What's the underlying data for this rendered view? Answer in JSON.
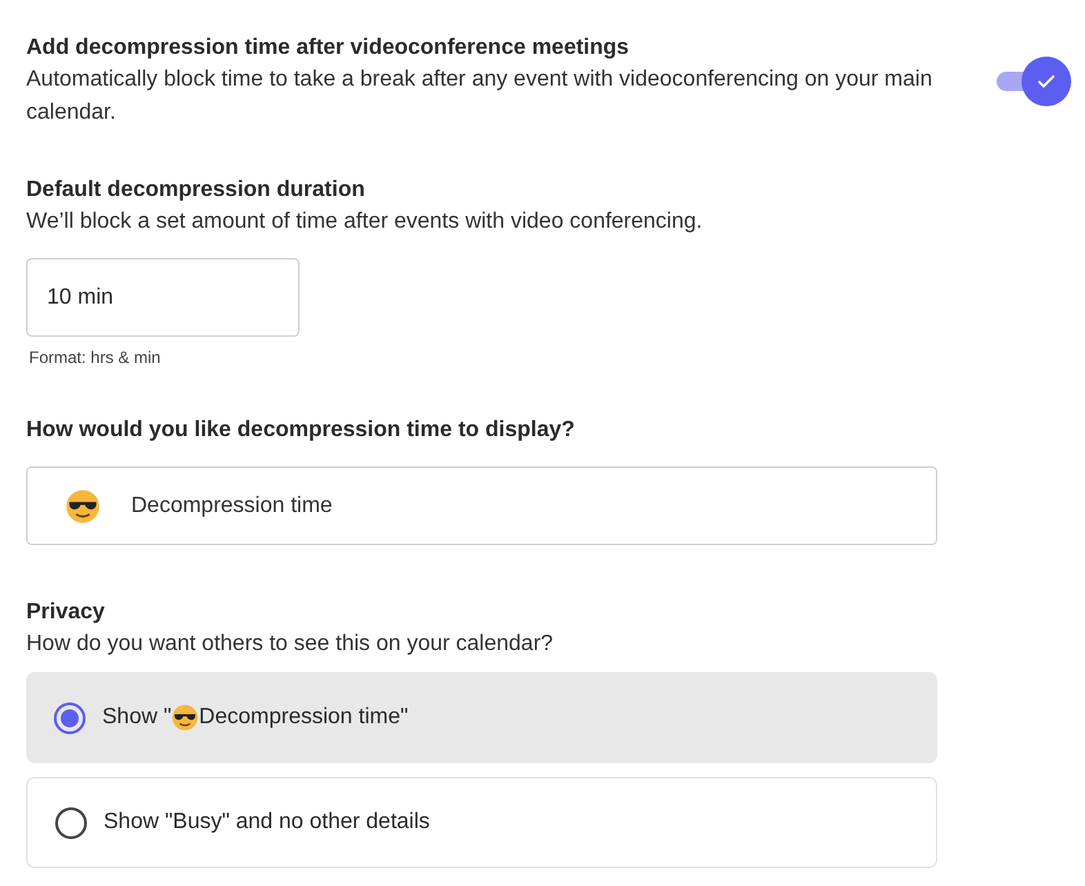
{
  "decompression": {
    "title": "Add decompression time after videoconference meetings",
    "description": "Automatically block time to take a break after any event with videoconferencing on your main calendar.",
    "on": true
  },
  "duration": {
    "title": "Default decompression duration",
    "description": "We’ll block a set amount of time after events with video conferencing.",
    "value": "10 min",
    "hint": "Format: hrs & min"
  },
  "display": {
    "title": "How would you like decompression time to display?",
    "value": "Decompression time"
  },
  "privacy": {
    "title": "Privacy",
    "description": "How do you want others to see this on your calendar?",
    "options": [
      {
        "kind": "emoji",
        "label_start": "Show \"",
        "label_end": "Decompression time\"",
        "selected": true
      },
      {
        "kind": "plain",
        "label_start": "Show \"Busy\" and no other details",
        "selected": false
      }
    ]
  }
}
